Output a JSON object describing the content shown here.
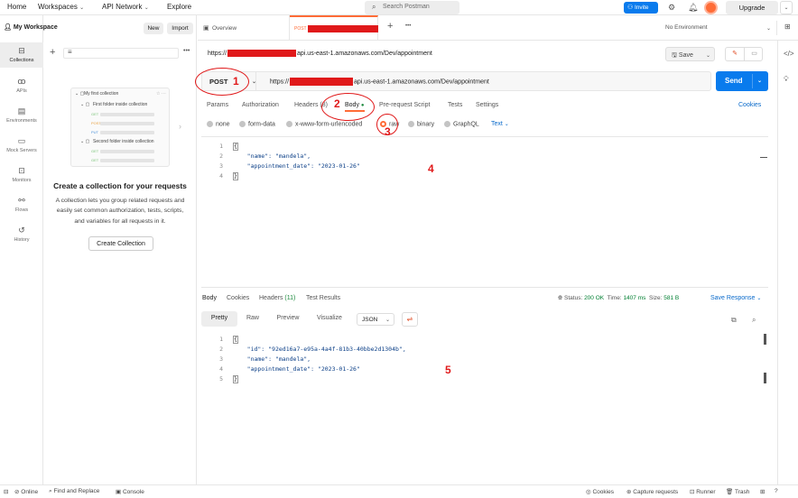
{
  "topbar": {
    "home": "Home",
    "workspaces": "Workspaces",
    "api_network": "API Network",
    "explore": "Explore",
    "search_placeholder": "Search Postman",
    "invite": "Invite",
    "upgrade": "Upgrade"
  },
  "rail": {
    "items": [
      {
        "label": "Collections",
        "icon": "collections-icon"
      },
      {
        "label": "APIs",
        "icon": "api-icon"
      },
      {
        "label": "Environments",
        "icon": "environments-icon"
      },
      {
        "label": "Mock Servers",
        "icon": "mock-servers-icon"
      },
      {
        "label": "Monitors",
        "icon": "monitors-icon"
      },
      {
        "label": "Flows",
        "icon": "flows-icon"
      },
      {
        "label": "History",
        "icon": "history-icon"
      }
    ]
  },
  "sidebar": {
    "workspace": "My Workspace",
    "new": "New",
    "import": "Import",
    "illustration": {
      "collection": "My first collection",
      "folder1": "First folder inside collection",
      "folder2": "Second folder inside collection",
      "methods": [
        "GET",
        "POST",
        "PUT",
        "GET",
        "GET"
      ]
    },
    "empty_title": "Create a collection for your requests",
    "empty_desc": "A collection lets you group related requests and easily set common authorization, tests, scripts, and variables for all requests in it.",
    "create_button": "Create Collection"
  },
  "tabs": {
    "overview": "Overview",
    "active_method": "POST",
    "environment": "No Environment"
  },
  "request": {
    "title_prefix": "https://",
    "title_suffix": "api.us-east-1.amazonaws.com/Dev/appointment",
    "save": "Save",
    "method": "POST",
    "url_prefix": "https://",
    "url_suffix": "api.us-east-1.amazonaws.com/Dev/appointment",
    "send": "Send",
    "tabs": [
      "Params",
      "Authorization",
      "Headers (8)",
      "Body",
      "Pre-request Script",
      "Tests",
      "Settings"
    ],
    "cookies": "Cookies",
    "body_modes": [
      "none",
      "form-data",
      "x-www-form-urlencoded",
      "raw",
      "binary",
      "GraphQL"
    ],
    "text_mode": "Text",
    "body_lines": [
      {
        "n": "1",
        "t": "{"
      },
      {
        "n": "2",
        "t": "    \"name\": \"mandela\","
      },
      {
        "n": "3",
        "t": "    \"appointment_date\": \"2023-01-26\""
      },
      {
        "n": "4",
        "t": "}"
      }
    ]
  },
  "response": {
    "tabs": [
      "Body",
      "Cookies",
      "Headers",
      "Test Results"
    ],
    "headers_count": "(11)",
    "status_label": "Status:",
    "status": "200 OK",
    "time_label": "Time:",
    "time": "1407 ms",
    "size_label": "Size:",
    "size": "581 B",
    "save_response": "Save Response",
    "formats": [
      "Pretty",
      "Raw",
      "Preview",
      "Visualize"
    ],
    "format_type": "JSON",
    "body_lines": [
      {
        "n": "1",
        "t": "{"
      },
      {
        "n": "2",
        "t": "    \"id\": \"92ed16a7-e95a-4a4f-81b3-40bbe2d1304b\","
      },
      {
        "n": "3",
        "t": "    \"name\": \"mandela\","
      },
      {
        "n": "4",
        "t": "    \"appointment_date\": \"2023-01-26\""
      },
      {
        "n": "5",
        "t": "}"
      }
    ]
  },
  "annotations": [
    "1",
    "2",
    "3",
    "4",
    "5"
  ],
  "bottom": {
    "online": "Online",
    "find_replace": "Find and Replace",
    "console": "Console",
    "cookies": "Cookies",
    "capture": "Capture requests",
    "runner": "Runner",
    "trash": "Trash"
  },
  "colors": {
    "accent": "#ff6c37",
    "primary": "#097bed",
    "annotation": "#e0191a",
    "ok": "#007f31"
  }
}
